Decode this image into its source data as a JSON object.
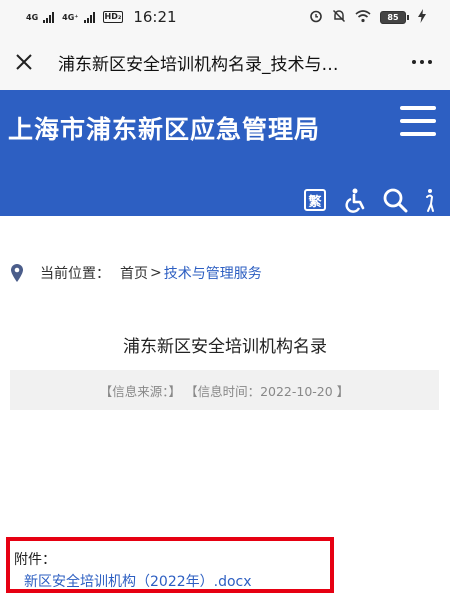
{
  "status_bar": {
    "network_1": "4G",
    "network_2": "4G⁺",
    "hd_badge": "HD₂",
    "time": "16:21",
    "battery": "85"
  },
  "title_bar": {
    "title": "浦东新区安全培训机构名录_技术与…"
  },
  "header": {
    "site_name": "上海市浦东新区应急管理局",
    "traditional_label": "繁"
  },
  "breadcrumb": {
    "label": "当前位置：",
    "home": "首页",
    "separator": ">",
    "current": "技术与管理服务"
  },
  "article": {
    "title": "浦东新区安全培训机构名录",
    "source_label": "【信息来源：】",
    "date_label": "【信息时间：2022-10-20 】"
  },
  "attachment": {
    "label": "附件：",
    "file_name": "新区安全培训机构（2022年）.docx",
    "highlight_color": "#e60012"
  },
  "colors": {
    "header_bg": "#2d5fc2",
    "link": "#2d5fc2"
  },
  "icons": [
    "close-icon",
    "more-icon",
    "menu-icon",
    "accessibility-icon",
    "search-icon",
    "elder-mode-icon",
    "location-pin-icon",
    "alarm-icon",
    "mute-icon",
    "wifi-icon",
    "battery-icon",
    "charging-icon"
  ]
}
